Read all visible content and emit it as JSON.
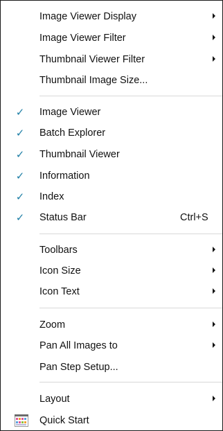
{
  "menu": {
    "items": [
      {
        "label": "Image Viewer Display",
        "checked": false,
        "submenu": true,
        "shortcut": ""
      },
      {
        "label": "Image Viewer Filter",
        "checked": false,
        "submenu": true,
        "shortcut": ""
      },
      {
        "label": "Thumbnail Viewer Filter",
        "checked": false,
        "submenu": true,
        "shortcut": ""
      },
      {
        "label": "Thumbnail Image Size...",
        "checked": false,
        "submenu": false,
        "shortcut": ""
      },
      {
        "label": "Image Viewer",
        "checked": true,
        "submenu": false,
        "shortcut": ""
      },
      {
        "label": "Batch Explorer",
        "checked": true,
        "submenu": false,
        "shortcut": ""
      },
      {
        "label": "Thumbnail Viewer",
        "checked": true,
        "submenu": false,
        "shortcut": ""
      },
      {
        "label": "Information",
        "checked": true,
        "submenu": false,
        "shortcut": ""
      },
      {
        "label": "Index",
        "checked": true,
        "submenu": false,
        "shortcut": ""
      },
      {
        "label": "Status Bar",
        "checked": true,
        "submenu": false,
        "shortcut": "Ctrl+S"
      },
      {
        "label": "Toolbars",
        "checked": false,
        "submenu": true,
        "shortcut": ""
      },
      {
        "label": "Icon Size",
        "checked": false,
        "submenu": true,
        "shortcut": ""
      },
      {
        "label": "Icon Text",
        "checked": false,
        "submenu": true,
        "shortcut": ""
      },
      {
        "label": "Zoom",
        "checked": false,
        "submenu": true,
        "shortcut": ""
      },
      {
        "label": "Pan All Images to",
        "checked": false,
        "submenu": true,
        "shortcut": ""
      },
      {
        "label": "Pan Step Setup...",
        "checked": false,
        "submenu": false,
        "shortcut": ""
      },
      {
        "label": "Layout",
        "checked": false,
        "submenu": true,
        "shortcut": ""
      },
      {
        "label": "Quick Start",
        "checked": false,
        "submenu": false,
        "shortcut": "",
        "icon": "quick-start-icon"
      }
    ],
    "check_glyph": "✓",
    "colors": {
      "check": "#1f7fa6",
      "text": "#111111",
      "separator": "#d8d8d8",
      "border": "#1a1a1a"
    }
  }
}
